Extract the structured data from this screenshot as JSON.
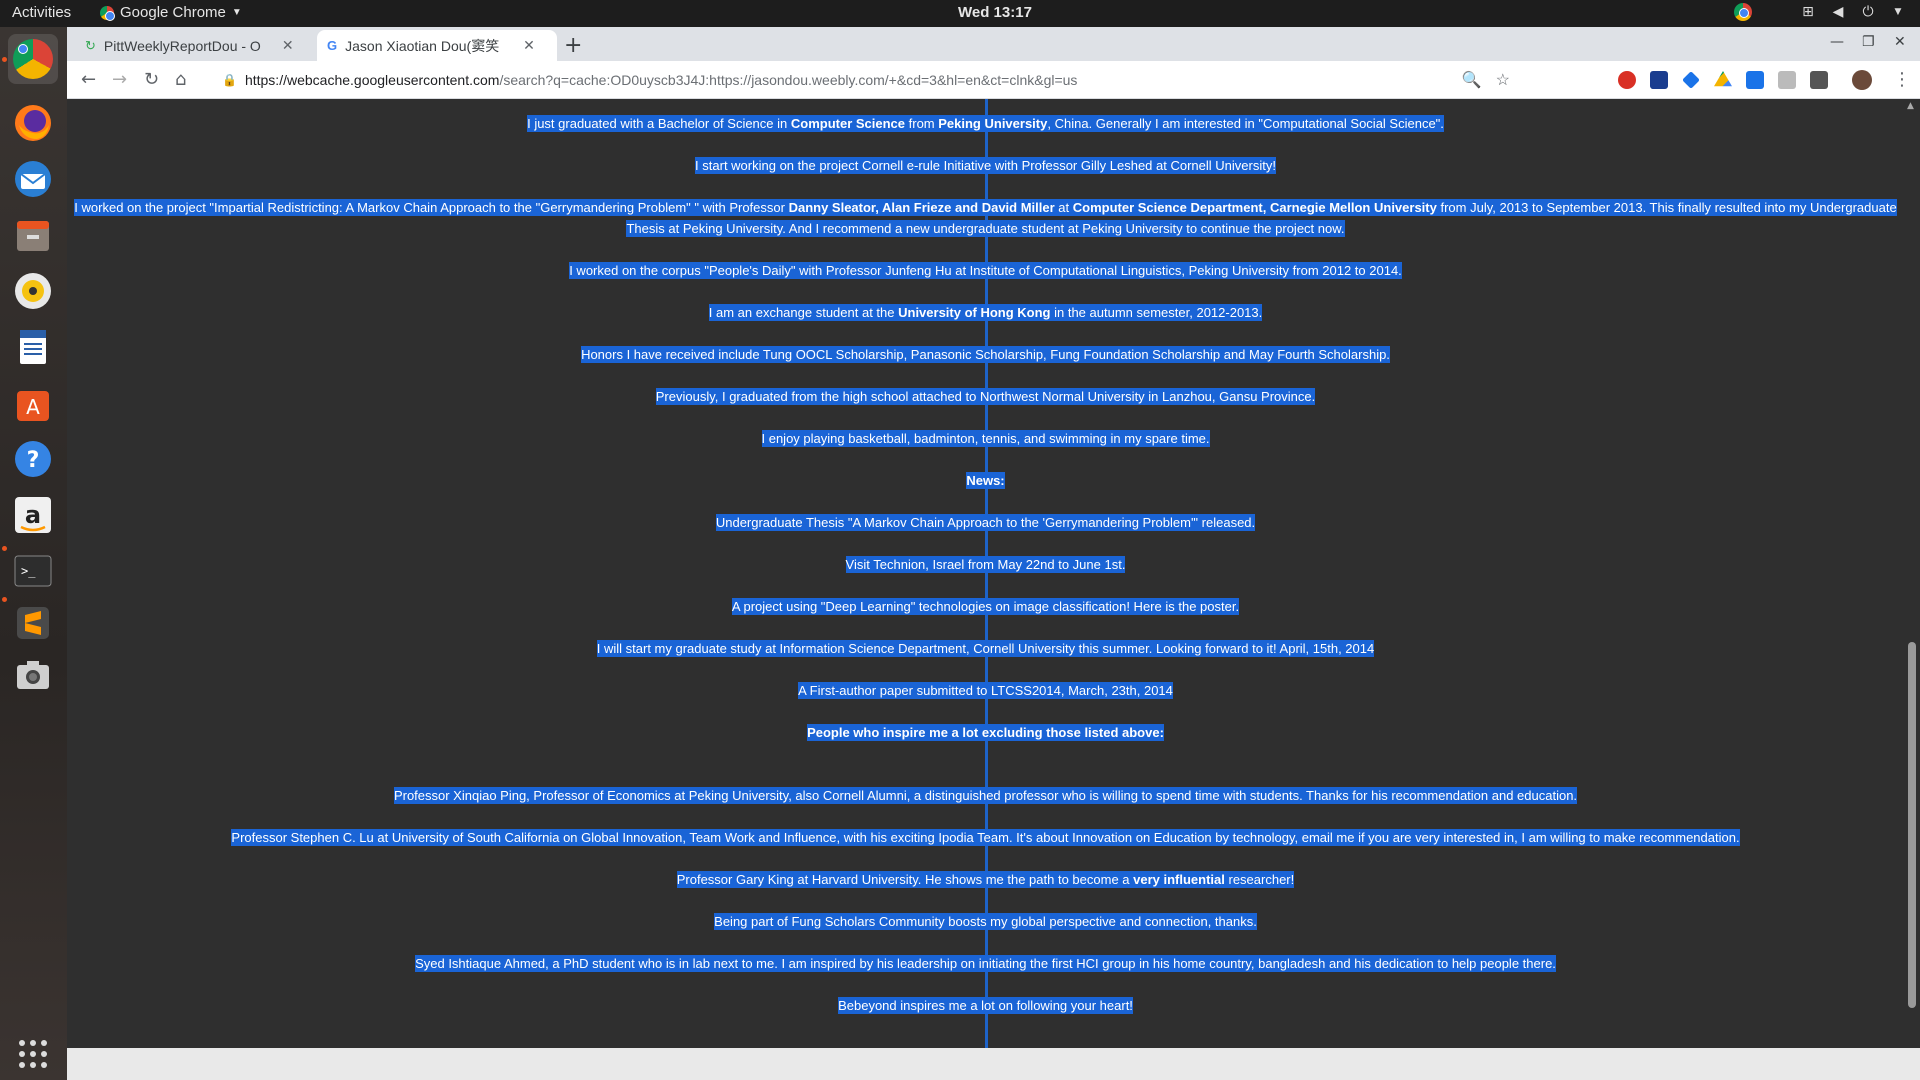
{
  "topbar": {
    "activities": "Activities",
    "app_name": "Google Chrome",
    "clock": "Wed 13:17"
  },
  "dock": {
    "items": [
      "chrome",
      "firefox",
      "thunderbird",
      "files",
      "rhythmbox",
      "writer",
      "software",
      "help",
      "amazon",
      "terminal",
      "sublime",
      "screenshot",
      "show-apps"
    ]
  },
  "browser": {
    "tabs": [
      {
        "title": "PittWeeklyReportDou - O"
      },
      {
        "title": "Jason Xiaotian Dou(窦笑"
      }
    ],
    "url_host": "https://webcache.googleusercontent.com",
    "url_rest": "/search?q=cache:OD0uyscb3J4J:https://jasondou.weebly.com/+&cd=3&hl=en&ct=clnk&gl=us"
  },
  "content": {
    "p1": {
      "a": "I just graduated with a Bachelor of Science in ",
      "b1": "Computer Science",
      "c": " from ",
      "b2": "Peking University",
      "d": ", China. Generally I am interested in  \"Computational Social Science\"."
    },
    "p2": "I start working on the project Cornell e-rule Initiative with Professor Gilly Leshed at Cornell University!",
    "p3": {
      "a": "I worked on the project \"Impartial Redistricting: A Markov Chain Approach to the \"Gerrymandering Problem\" \" with Professor ",
      "b1": "Danny Sleator, Alan Frieze and David Miller",
      "c": " at ",
      "b2": "Computer Science Department, Carnegie Mellon University",
      "d": " from July, 2013 to September 2013. This finally resulted into my Undergraduate",
      "line2": "Thesis at Peking University. And I recommend a new undergraduate student at Peking University to continue the project now."
    },
    "p4": "I worked on the corpus \"People's Daily\" with Professor Junfeng Hu at Institute of Computational Linguistics, Peking University from 2012 to 2014.",
    "p5": {
      "a": "I am an exchange student at the ",
      "b1": "University of Hong Kong",
      "c": " in the autumn semester, 2012-2013."
    },
    "p6": "Honors I have received include Tung OOCL Scholarship, Panasonic Scholarship, Fung Foundation Scholarship and May Fourth Scholarship.",
    "p7": "Previously, I graduated from the high school attached to Northwest Normal University in Lanzhou, Gansu Province.",
    "p8": "I enjoy playing basketball, badminton, tennis, and swimming in my spare time.",
    "news_heading": "News:",
    "n1": "Undergraduate Thesis \"A Markov Chain Approach to the 'Gerrymandering Problem'\" released.",
    "n2": "Visit Technion, Israel from May 22nd to June 1st.",
    "n3": "A project using \"Deep Learning\" technologies on image classification! Here is the poster.",
    "n4": "I will start my graduate study at Information Science Department, Cornell University this summer. Looking forward to it!  April, 15th, 2014",
    "n5": "A First-author paper submitted to LTCSS2014, March, 23th, 2014",
    "inspire_heading": "People who inspire me a lot excluding those listed above:",
    "i1": "Professor Xinqiao Ping, Professor of Economics at Peking University, also Cornell Alumni, a distinguished professor who is willing to spend time with students. Thanks for his recommendation and education.",
    "i2": "Professor Stephen C. Lu  at University of South California on Global Innovation, Team Work and Influence, with his exciting Ipodia Team. It's about Innovation on Education by technology, email me if you are very interested in, I am willing to make recommendation.",
    "i3": {
      "a": "Professor Gary King at Harvard University. He shows me the path to become a ",
      "b1": "very influential",
      "c": " researcher!"
    },
    "i4": "Being part of Fung Scholars Community boosts my global perspective and connection, thanks.",
    "i5": "Syed Ishtiaque Ahmed, a PhD student who is in lab next to me. I am inspired by his leadership on initiating the first HCI group in his home country, bangladesh and his dedication to help people there.",
    "i6": "Bebeyond inspires me a lot on following your heart!"
  }
}
